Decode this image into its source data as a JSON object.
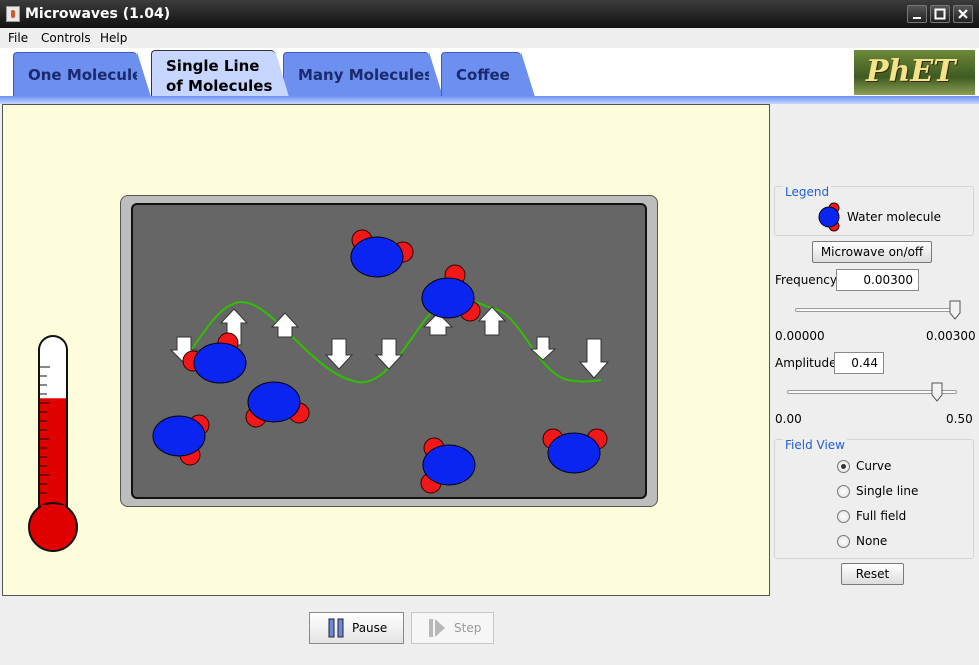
{
  "window": {
    "title": "Microwaves (1.04)"
  },
  "menu": [
    "File",
    "Controls",
    "Help"
  ],
  "tabs": [
    {
      "label": "One Molecule",
      "selected": false
    },
    {
      "label_line1": "Single Line",
      "label_line2": "of Molecules",
      "selected": true
    },
    {
      "label": "Many Molecules",
      "selected": false
    },
    {
      "label": "Coffee",
      "selected": false
    }
  ],
  "logo_text": "PhET",
  "legend": {
    "title": "Legend",
    "water_label": "Water molecule"
  },
  "controls": {
    "microwave_button": "Microwave on/off",
    "frequency_label": "Frequency",
    "frequency_value": "0.00300",
    "frequency_min": "0.00000",
    "frequency_max": "0.00300",
    "frequency_level": 1.0,
    "amplitude_label": "Amplitude",
    "amplitude_value": "0.44",
    "amplitude_min": "0.00",
    "amplitude_max": "0.50",
    "amplitude_level": 0.88,
    "reset_button": "Reset"
  },
  "field_view": {
    "title": "Field View",
    "options": [
      "Curve",
      "Single line",
      "Full field",
      "None"
    ],
    "selected": "Curve"
  },
  "clock": {
    "pause_label": "Pause",
    "step_label": "Step"
  },
  "thermometer_level": 0.72,
  "colors": {
    "tab_fill": "#6c8ff0",
    "tab_selected": "#c6d6ff",
    "play_area": "#fdfddc",
    "oven_cavity": "#666666",
    "oxygen": "#0a25f0",
    "hydrogen": "#f01818",
    "wave": "#2fc000",
    "thermometer": "#e00000",
    "group_title": "#2060d8"
  }
}
